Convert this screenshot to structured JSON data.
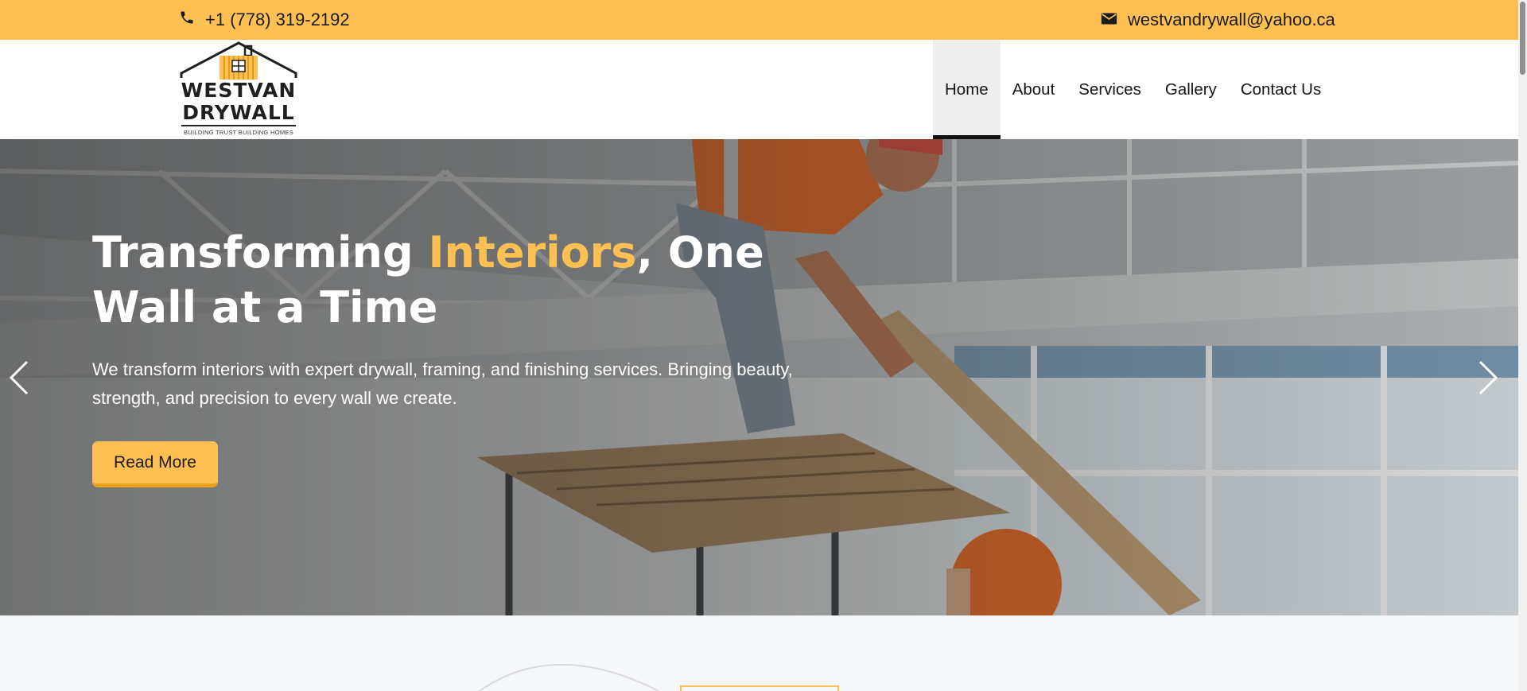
{
  "topbar": {
    "phone": "+1 (778) 319-2192",
    "email": "westvandrywall@yahoo.ca",
    "phone_icon": "phone-icon",
    "email_icon": "mail-icon"
  },
  "logo": {
    "line1": "WESTVAN",
    "line2": "DRYWALL",
    "tagline": "BUILDING TRUST BUILDING HOMES"
  },
  "nav": {
    "items": [
      {
        "label": "Home",
        "active": true
      },
      {
        "label": "About",
        "active": false
      },
      {
        "label": "Services",
        "active": false
      },
      {
        "label": "Gallery",
        "active": false
      },
      {
        "label": "Contact Us",
        "active": false
      }
    ]
  },
  "hero": {
    "title_part1": "Transforming ",
    "title_accent": "Interiors",
    "title_part2": ", One Wall at a Time",
    "text": "We transform interiors with expert drywall, framing, and finishing services. Bringing beauty, strength, and precision to every wall we create.",
    "button_label": "Read More",
    "prev_icon": "chevron-left-icon",
    "next_icon": "chevron-right-icon"
  },
  "colors": {
    "accent": "#fec052",
    "topbar_bg": "#fec052",
    "text_dark": "#1b1b1b",
    "hero_text": "#ffffff"
  }
}
